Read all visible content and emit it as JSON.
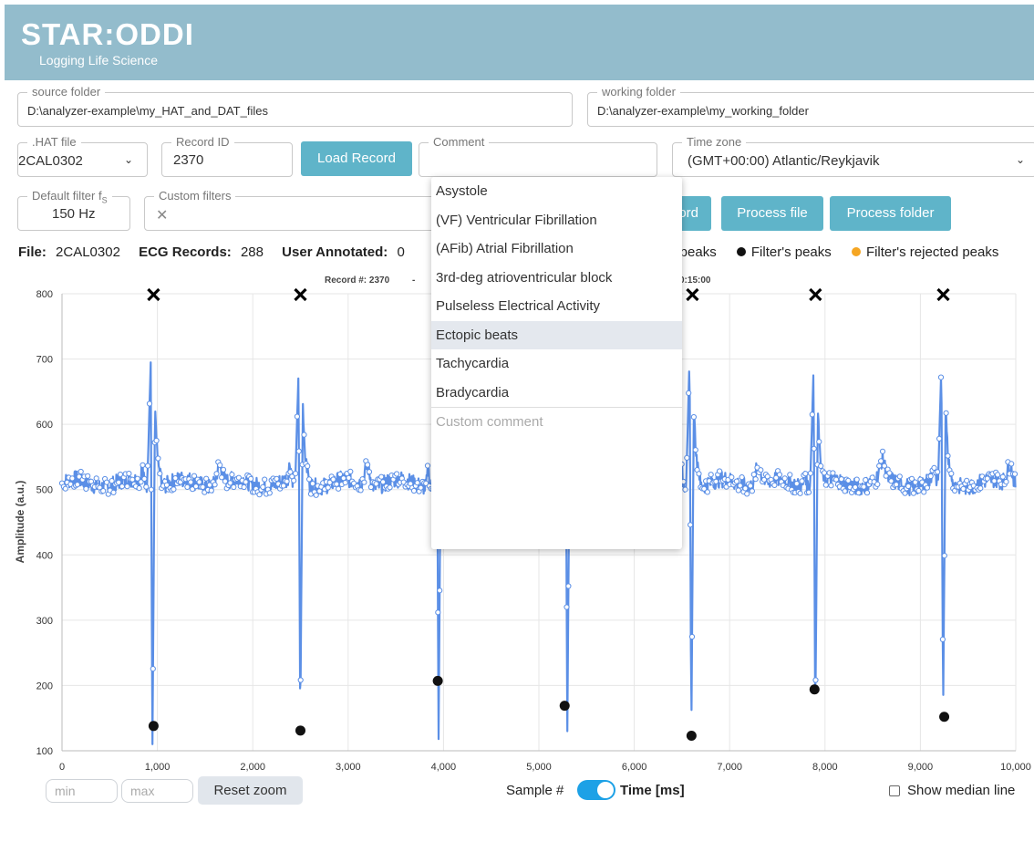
{
  "header": {
    "logo": "STAR:ODDI",
    "tagline": "Logging Life Science"
  },
  "source_folder": {
    "label": "source folder",
    "value": "D:\\analyzer-example\\my_HAT_and_DAT_files"
  },
  "working_folder": {
    "label": "working folder",
    "value": "D:\\analyzer-example\\my_working_folder"
  },
  "hat_file": {
    "label": ".HAT file",
    "value": "2CAL0302"
  },
  "record_id": {
    "label": "Record ID",
    "value": "2370"
  },
  "load_record_label": "Load Record",
  "comment": {
    "label": "Comment",
    "value": ""
  },
  "time_zone": {
    "label": "Time zone",
    "value": "(GMT+00:00) Atlantic/Reykjavik"
  },
  "default_filter": {
    "label": "Default filter f",
    "label_sub": "S",
    "value": "150 Hz"
  },
  "custom_filters": {
    "label": "Custom filters",
    "clear_glyph": "✕"
  },
  "buttons": {
    "record_partial": "ord",
    "process_file": "Process file",
    "process_folder": "Process folder"
  },
  "info": {
    "file_label": "File:",
    "file_value": "2CAL0302",
    "ecg_label": "ECG Records:",
    "ecg_value": "288",
    "annot_label": "User Annotated:",
    "annot_value": "0"
  },
  "legend": {
    "partial": "s peaks",
    "filter_peaks": "Filter's peaks",
    "rejected_peaks": "Filter's rejected peaks",
    "filter_color": "#111111",
    "rejected_color": "#f5a623"
  },
  "chart_header": {
    "left": "Record #: 2370",
    "sep": "-",
    "frag1": "I",
    "right": "0:15:00"
  },
  "dropdown": {
    "items": [
      "Asystole",
      "(VF) Ventricular Fibrillation",
      "(AFib) Atrial Fibrillation",
      "3rd-deg atrioventricular block",
      "Pulseless Electrical Activity",
      "Ectopic beats",
      "Tachycardia",
      "Bradycardia"
    ],
    "highlighted": "Ectopic beats",
    "custom_placeholder": "Custom comment"
  },
  "controls": {
    "min_placeholder": "min",
    "max_placeholder": "max",
    "reset_zoom": "Reset zoom",
    "sample_label": "Sample #",
    "time_label": "Time [ms]",
    "time_toggle_on": true,
    "show_median": "Show median line",
    "show_median_checked": false
  },
  "chart_data": {
    "type": "line",
    "ylabel": "Amplitude (a.u.)",
    "xlim": [
      0,
      10000
    ],
    "ylim": [
      100,
      800
    ],
    "xticks": [
      "0",
      "1,000",
      "2,000",
      "3,000",
      "4,000",
      "5,000",
      "6,000",
      "7,000",
      "8,000",
      "9,000",
      "10,000"
    ],
    "yticks": [
      "100",
      "200",
      "300",
      "400",
      "500",
      "600",
      "700",
      "800"
    ],
    "grid": true,
    "line_color": "#5b8fe6",
    "baseline": 510,
    "beats": [
      {
        "x": 930,
        "peak": 695,
        "trough": 110
      },
      {
        "x": 2480,
        "peak": 680,
        "trough": 135
      },
      {
        "x": 3930,
        "peak": 700,
        "trough": 118
      },
      {
        "x": 5280,
        "peak": 700,
        "trough": 130
      },
      {
        "x": 6580,
        "peak": 703,
        "trough": 125
      },
      {
        "x": 7880,
        "peak": 685,
        "trough": 135
      },
      {
        "x": 9220,
        "peak": 693,
        "trough": 150
      }
    ],
    "filter_peaks": [
      {
        "x": 960,
        "y": 138
      },
      {
        "x": 2500,
        "y": 131
      },
      {
        "x": 3940,
        "y": 207
      },
      {
        "x": 5270,
        "y": 169
      },
      {
        "x": 6600,
        "y": 123
      },
      {
        "x": 7890,
        "y": 194
      },
      {
        "x": 9250,
        "y": 152
      }
    ],
    "x_markers": [
      960,
      2500,
      6610,
      7900,
      9240
    ]
  }
}
